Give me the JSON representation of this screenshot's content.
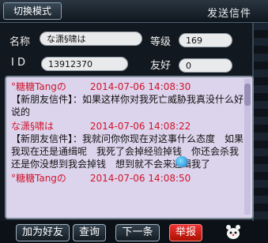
{
  "window": {
    "title": "发送信件",
    "mode_tab": "切换模式"
  },
  "profile": {
    "name_label": "名称",
    "name_value": "な潇§啸は",
    "level_label": "等级",
    "level_value": "169",
    "id_label": "I D",
    "id_value": "13912370",
    "friend_label": "友好",
    "friend_value": "0"
  },
  "messages": [
    {
      "sender": "°糖糖Tangの",
      "time": "2014-07-06 14:08:30",
      "text": "【新朋友信件】：如果这样你对我死亡威胁我真没什么好说的"
    },
    {
      "sender": "な潇§啸は",
      "time": "2014-07-06 14:08:22",
      "text": "【新朋友信件】：我就问你你现在对这事什么态度　如果我现在还是通缉呢　我死了会掉经验掉钱　你还会杀我 还是你没想到我会掉钱　想到就不会来通缉我了"
    },
    {
      "sender": "°糖糖Tangの",
      "time": "2014-07-06 14:08:50",
      "text": ""
    }
  ],
  "buttons": {
    "add_friend": "加为好友",
    "lookup": "查询",
    "next": "下一条",
    "report": "举报"
  },
  "colors": {
    "sender_red": "#d0142c",
    "chat_bg": "#dcd4ec",
    "report_red": "#e33"
  },
  "icons": {
    "sticker": "globe-sticker-icon",
    "pet": "pet-icon"
  }
}
